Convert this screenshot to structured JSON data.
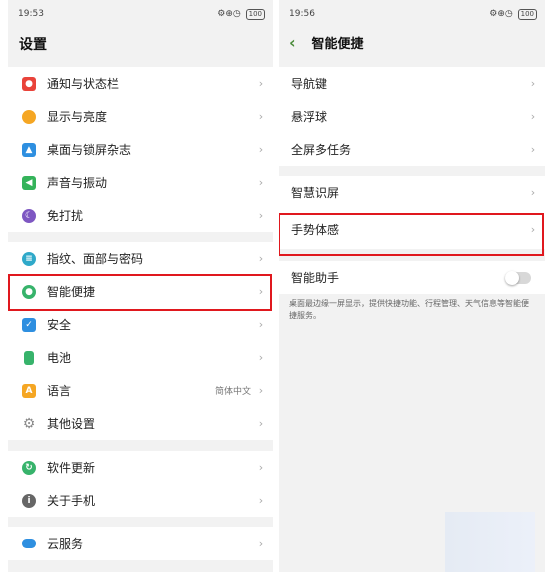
{
  "left": {
    "status": {
      "time": "19:53",
      "signal": "ᴺ∦l ⌇ ≡",
      "icons_right": "⚙⊕◷",
      "battery": "100"
    },
    "title": "设置",
    "groups": [
      {
        "items": [
          {
            "label": "通知与状态栏",
            "icon": "bell-icon",
            "color": "#e9433a"
          },
          {
            "label": "显示与亮度",
            "icon": "brightness-icon",
            "color": "#f5a623"
          },
          {
            "label": "桌面与锁屏杂志",
            "icon": "wallpaper-icon",
            "color": "#2e8fe0"
          },
          {
            "label": "声音与振动",
            "icon": "speaker-icon",
            "color": "#34b35a"
          },
          {
            "label": "免打扰",
            "icon": "moon-icon",
            "color": "#7e57c2"
          }
        ]
      },
      {
        "items": [
          {
            "label": "指纹、面部与密码",
            "icon": "fingerprint-icon",
            "color": "#2fa9c9"
          },
          {
            "label": "智能便捷",
            "icon": "smart-icon",
            "color": "#37b36b"
          },
          {
            "label": "安全",
            "icon": "shield-icon",
            "color": "#2e8fe0"
          },
          {
            "label": "电池",
            "icon": "battery-icon",
            "color": "#37b36b"
          },
          {
            "label": "语言",
            "icon": "language-icon",
            "color": "#f5a623",
            "value": "简体中文"
          },
          {
            "label": "其他设置",
            "icon": "gear-icon",
            "color": "#8a8a8a"
          }
        ]
      },
      {
        "items": [
          {
            "label": "软件更新",
            "icon": "update-icon",
            "color": "#37b36b"
          },
          {
            "label": "关于手机",
            "icon": "info-icon",
            "color": "#666666"
          }
        ]
      },
      {
        "items": [
          {
            "label": "云服务",
            "icon": "cloud-icon",
            "color": "#2e8fe0"
          }
        ]
      }
    ]
  },
  "right": {
    "status": {
      "time": "19:56",
      "signal": "ᴺ∦l ⌇ ≡",
      "icons_right": "⚙⊕◷",
      "battery": "100"
    },
    "title": "智能便捷",
    "groups": [
      {
        "items": [
          {
            "label": "导航键"
          },
          {
            "label": "悬浮球"
          },
          {
            "label": "全屏多任务"
          }
        ]
      },
      {
        "items": [
          {
            "label": "智慧识屏"
          },
          {
            "label": "手势体感"
          }
        ]
      },
      {
        "items": [
          {
            "label": "智能助手",
            "toggle": false
          }
        ]
      }
    ],
    "assistant_desc": "桌面最边缘一屏显示，提供快捷功能、行程管理、天气信息等智能便捷服务。"
  },
  "chevron": "›",
  "back_glyph": "‹",
  "highlight_color": "#e0181e"
}
